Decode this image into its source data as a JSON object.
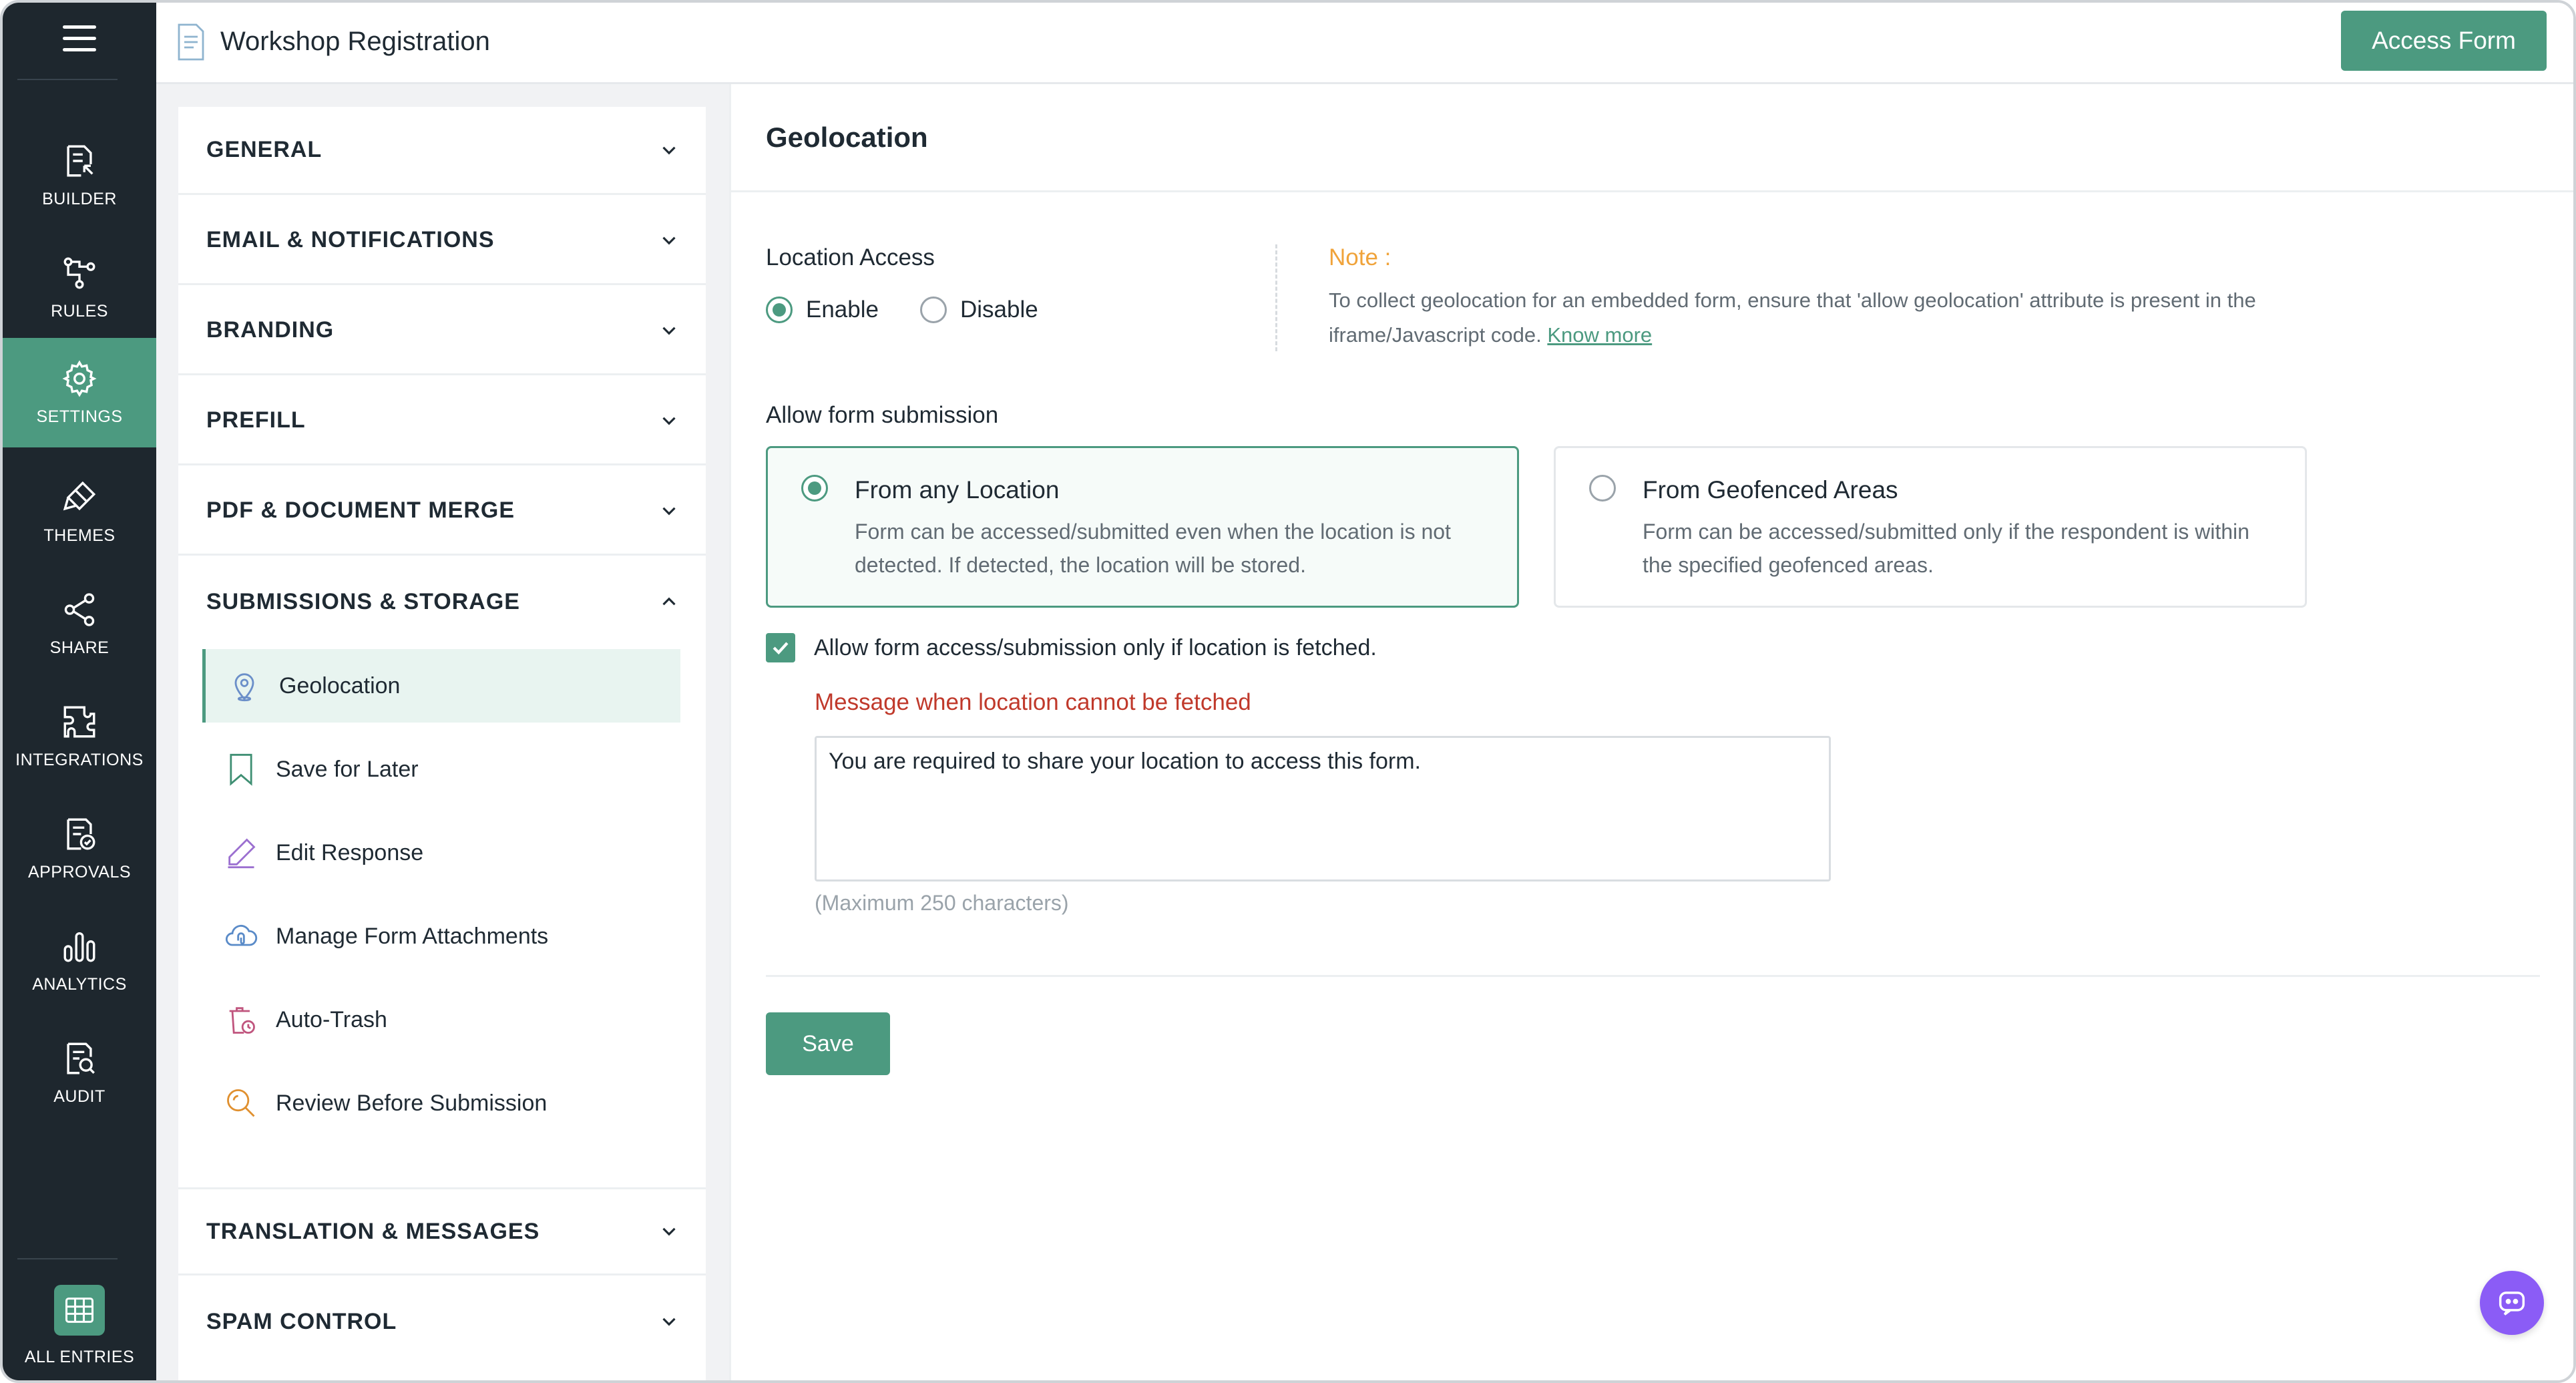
{
  "app": {
    "title": "Workshop Registration",
    "access_button": "Access Form",
    "accent": "#4c9a80"
  },
  "rail": {
    "items": [
      {
        "label": "BUILDER",
        "icon": "builder-icon"
      },
      {
        "label": "RULES",
        "icon": "rules-icon"
      },
      {
        "label": "SETTINGS",
        "icon": "gear-icon",
        "active": true
      },
      {
        "label": "THEMES",
        "icon": "themes-icon"
      },
      {
        "label": "SHARE",
        "icon": "share-icon"
      },
      {
        "label": "INTEGRATIONS",
        "icon": "integrations-icon"
      },
      {
        "label": "APPROVALS",
        "icon": "approvals-icon"
      },
      {
        "label": "ANALYTICS",
        "icon": "analytics-icon"
      },
      {
        "label": "AUDIT",
        "icon": "audit-icon"
      }
    ],
    "bottom_label": "ALL ENTRIES"
  },
  "settings": {
    "sections": [
      {
        "name": "GENERAL",
        "expanded": false
      },
      {
        "name": "EMAIL & NOTIFICATIONS",
        "expanded": false
      },
      {
        "name": "BRANDING",
        "expanded": false
      },
      {
        "name": "PREFILL",
        "expanded": false
      },
      {
        "name": "PDF & DOCUMENT MERGE",
        "expanded": false
      },
      {
        "name": "SUBMISSIONS & STORAGE",
        "expanded": true
      },
      {
        "name": "TRANSLATION & MESSAGES",
        "expanded": false
      },
      {
        "name": "SPAM CONTROL",
        "expanded": false
      }
    ],
    "sub_items": [
      {
        "label": "Geolocation",
        "icon": "location-pin-icon",
        "active": true
      },
      {
        "label": "Save for Later",
        "icon": "bookmark-icon"
      },
      {
        "label": "Edit Response",
        "icon": "pencil-icon"
      },
      {
        "label": "Manage Form Attachments",
        "icon": "cloud-attachment-icon"
      },
      {
        "label": "Auto-Trash",
        "icon": "trash-clock-icon"
      },
      {
        "label": "Review Before Submission",
        "icon": "magnifier-icon"
      }
    ]
  },
  "main": {
    "heading": "Geolocation",
    "location_access": {
      "label": "Location Access",
      "options": [
        "Enable",
        "Disable"
      ],
      "selected": "Enable"
    },
    "note": {
      "title": "Note :",
      "text": "To collect geolocation for an embedded form, ensure that 'allow geolocation' attribute is present in the iframe/Javascript code.",
      "link": "Know more"
    },
    "allow_submission": {
      "label": "Allow form submission",
      "options": [
        {
          "title": "From any Location",
          "desc": "Form can be accessed/submitted even when the location is not detected. If detected, the location will be stored.",
          "selected": true
        },
        {
          "title": "From Geofenced Areas",
          "desc": "Form can be accessed/submitted only if the respondent is within the specified geofenced areas.",
          "selected": false
        }
      ]
    },
    "checkbox": {
      "label": "Allow form access/submission only if location is fetched.",
      "checked": true
    },
    "message": {
      "label": "Message when location cannot be fetched",
      "value": "You are required to share your location to access this form.",
      "hint": "(Maximum 250 characters)"
    },
    "save_label": "Save"
  }
}
